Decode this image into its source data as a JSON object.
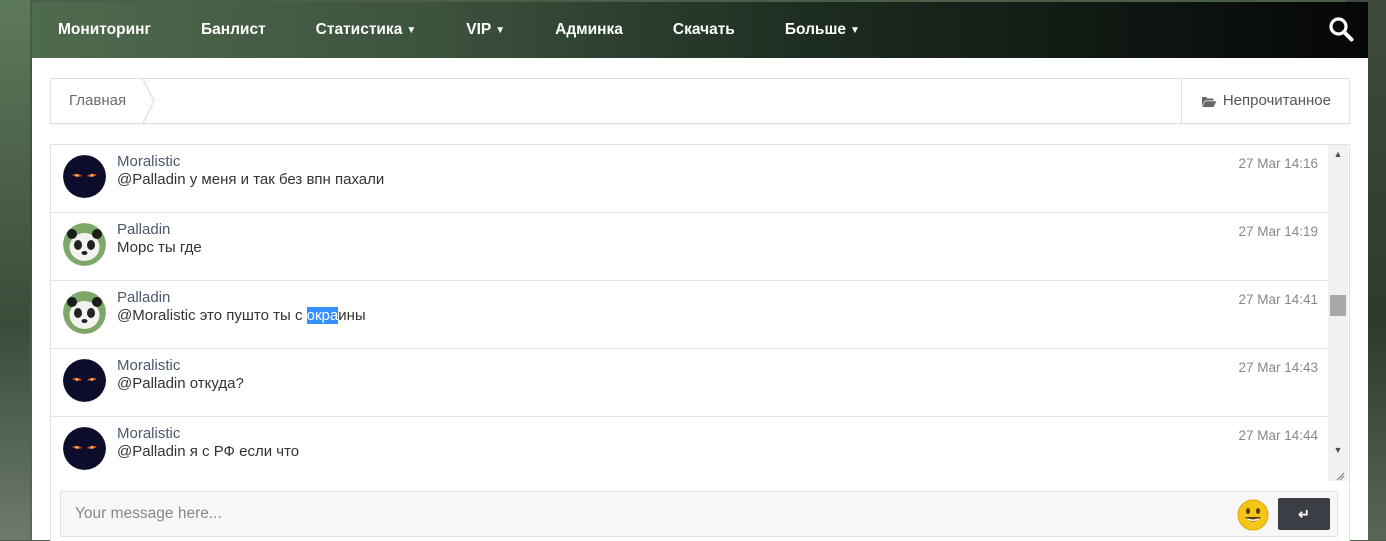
{
  "nav": {
    "items": [
      {
        "label": "Мониторинг",
        "dropdown": false
      },
      {
        "label": "Банлист",
        "dropdown": false
      },
      {
        "label": "Статистика",
        "dropdown": true
      },
      {
        "label": "VIP",
        "dropdown": true
      },
      {
        "label": "Админка",
        "dropdown": false
      },
      {
        "label": "Скачать",
        "dropdown": false
      },
      {
        "label": "Больше",
        "dropdown": true
      }
    ],
    "search_icon": "search-icon"
  },
  "breadcrumb": {
    "home": "Главная",
    "unread": "Непрочитанное",
    "unread_icon": "folder-open-icon"
  },
  "chat": {
    "messages": [
      {
        "author": "Moralistic",
        "text": "@Palladin у меня и так без впн пахали",
        "time": "27 Mar 14:16",
        "avatar": "dark-eyes-avatar"
      },
      {
        "author": "Palladin",
        "text": "Морс ты где",
        "time": "27 Mar 14:19",
        "avatar": "panda-avatar"
      },
      {
        "author": "Palladin",
        "text_before": "@Moralistic это пушто ты с ",
        "text_selected": "окра",
        "text_after": "ины",
        "time": "27 Mar 14:41",
        "avatar": "panda-avatar"
      },
      {
        "author": "Moralistic",
        "text": "@Palladin откуда?",
        "time": "27 Mar 14:43",
        "avatar": "dark-eyes-avatar"
      },
      {
        "author": "Moralistic",
        "text": "@Palladin я с РФ если что",
        "time": "27 Mar 14:44",
        "avatar": "dark-eyes-avatar"
      }
    ],
    "input_placeholder": "Your message here...",
    "send_label": "↵",
    "emoji_icon": "smiley-icon"
  },
  "colors": {
    "selection": "#3390ff",
    "author": "#4a5a6e",
    "send_button": "#3b3e45",
    "emoji": "#f5c518"
  }
}
